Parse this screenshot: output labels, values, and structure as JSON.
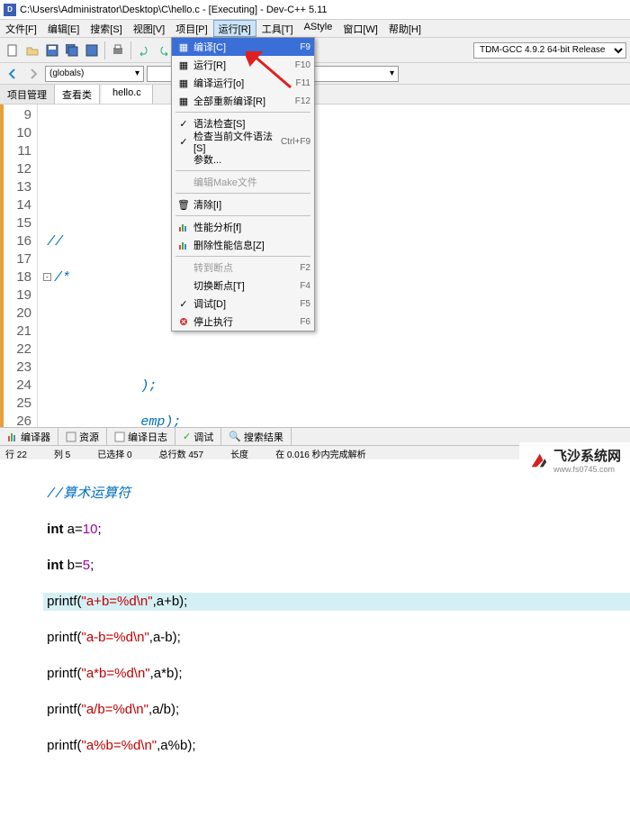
{
  "title": "C:\\Users\\Administrator\\Desktop\\C\\hello.c - [Executing] - Dev-C++ 5.11",
  "menubar": {
    "file": "文件[F]",
    "edit": "编辑[E]",
    "search": "搜索[S]",
    "view": "视图[V]",
    "project": "项目[P]",
    "run": "运行[R]",
    "tools": "工具[T]",
    "astyle": "AStyle",
    "window": "窗口[W]",
    "help": "帮助[H]"
  },
  "compiler": "TDM-GCC 4.9.2 64-bit Release",
  "globals": "(globals)",
  "sidebar": {
    "project": "项目管理",
    "classview": "查看类"
  },
  "filetab": "hello.c",
  "dropdown": {
    "compile": {
      "label": "编译[C]",
      "sc": "F9"
    },
    "run": {
      "label": "运行[R]",
      "sc": "F10"
    },
    "compile_run": {
      "label": "编译运行[o]",
      "sc": "F11"
    },
    "rebuild": {
      "label": "全部重新编译[R]",
      "sc": "F12"
    },
    "syntax": {
      "label": "语法检查[S]",
      "sc": ""
    },
    "syntax_current": {
      "label": "检查当前文件语法[S]",
      "sc": "Ctrl+F9"
    },
    "params": {
      "label": "参数...",
      "sc": ""
    },
    "makefile": {
      "label": "编辑Make文件",
      "sc": ""
    },
    "clean": {
      "label": "清除[I]",
      "sc": ""
    },
    "profile": {
      "label": "性能分析[f]",
      "sc": ""
    },
    "del_profile": {
      "label": "删除性能信息[Z]",
      "sc": ""
    },
    "goto_bp": {
      "label": "转到断点",
      "sc": "F2"
    },
    "toggle_bp": {
      "label": "切换断点[T]",
      "sc": "F4"
    },
    "debug": {
      "label": "调试[D]",
      "sc": "F5"
    },
    "stop": {
      "label": "停止执行",
      "sc": "F6"
    }
  },
  "code": {
    "comment1": "//算术运算符",
    "var_a": {
      "kw": "int",
      "name": " a=",
      "val": "10"
    },
    "var_b": {
      "kw": "int",
      "name": " b=",
      "val": "5"
    },
    "p1": {
      "fn": "printf(",
      "str": "\"a+b=%d\\n\"",
      "arg": ",a+b);"
    },
    "p2": {
      "fn": "printf(",
      "str": "\"a-b=%d\\n\"",
      "arg": ",a-b);"
    },
    "p3": {
      "fn": "printf(",
      "str": "\"a*b=%d\\n\"",
      "arg": ",a*b);"
    },
    "p4": {
      "fn": "printf(",
      "str": "\"a/b=%d\\n\"",
      "arg": ",a/b);"
    },
    "p5": {
      "fn": "printf(",
      "str": "\"a%b=%d\\n\"",
      "arg": ",a%b);"
    },
    "frag1": ");",
    "frag2": "emp);"
  },
  "bottom": {
    "compiler": "编译器",
    "resources": "资源",
    "log": "编译日志",
    "debug": "调试",
    "results": "搜索结果"
  },
  "status": {
    "line": "行 22",
    "col": "列 5",
    "sel": "已选择 0",
    "total": "总行数 457",
    "len": "长度",
    "msg": "在 0.016 秒内完成解析"
  },
  "watermark": {
    "line1": "飞沙系统网",
    "line2": "www.fs0745.com"
  }
}
